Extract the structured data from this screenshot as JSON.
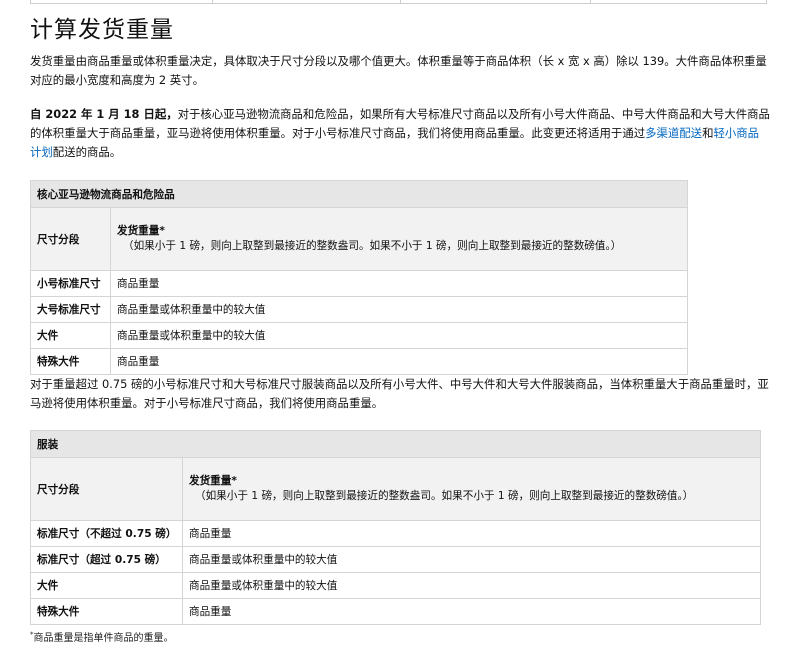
{
  "page": {
    "title": "计算发货重量",
    "intro": "发货重量由商品重量或体积重量决定，具体取决于尺寸分段以及哪个值更大。体积重量等于商品体积（长 x 宽 x 高）除以 139。大件商品体积重量对应的最小宽度和高度为 2 英寸。",
    "policy_bold": "自 2022 年 1 月 18 日起，",
    "policy_text": "对于核心亚马逊物流商品和危险品，如果所有大号标准尺寸商品以及所有小号大件商品、中号大件商品和大号大件商品的体积重量大于商品重量，亚马逊将使用体积重量。对于小号标准尺寸商品，我们将使用商品重量。此变更还将适用于通过",
    "policy_link1": "多渠道配送",
    "policy_and": "和",
    "policy_link2": "轻小商品计划",
    "policy_end": "配送的商品。",
    "apparel_note": "对于重量超过 0.75 磅的小号标准尺寸和大号标准尺寸服装商品以及所有小号大件、中号大件和大号大件服装商品，当体积重量大于商品重量时，亚马逊将使用体积重量。对于小号标准尺寸商品，我们将使用商品重量。",
    "footnote_mark": "*",
    "footnote": "商品重量是指单件商品的重量。"
  },
  "table1": {
    "title": "核心亚马逊物流商品和危险品",
    "col1": "尺寸分段",
    "col2_title": "发货重量*",
    "col2_sub": "（如果小于 1 磅，则向上取整到最接近的整数盎司。如果不小于 1 磅，则向上取整到最接近的整数磅值。）",
    "rows": [
      {
        "tier": "小号标准尺寸",
        "weight": "商品重量"
      },
      {
        "tier": "大号标准尺寸",
        "weight": "商品重量或体积重量中的较大值"
      },
      {
        "tier": "大件",
        "weight": "商品重量或体积重量中的较大值"
      },
      {
        "tier": "特殊大件",
        "weight": "商品重量"
      }
    ]
  },
  "table2": {
    "title": "服装",
    "col1": "尺寸分段",
    "col2_title": "发货重量*",
    "col2_sub": "（如果小于 1 磅，则向上取整到最接近的整数盎司。如果不小于 1 磅，则向上取整到最接近的整数磅值。）",
    "rows": [
      {
        "tier": "标准尺寸（不超过 0.75 磅）",
        "weight": "商品重量"
      },
      {
        "tier": "标准尺寸（超过 0.75 磅）",
        "weight": "商品重量或体积重量中的较大值"
      },
      {
        "tier": "大件",
        "weight": "商品重量或体积重量中的较大值"
      },
      {
        "tier": "特殊大件",
        "weight": "商品重量"
      }
    ]
  }
}
